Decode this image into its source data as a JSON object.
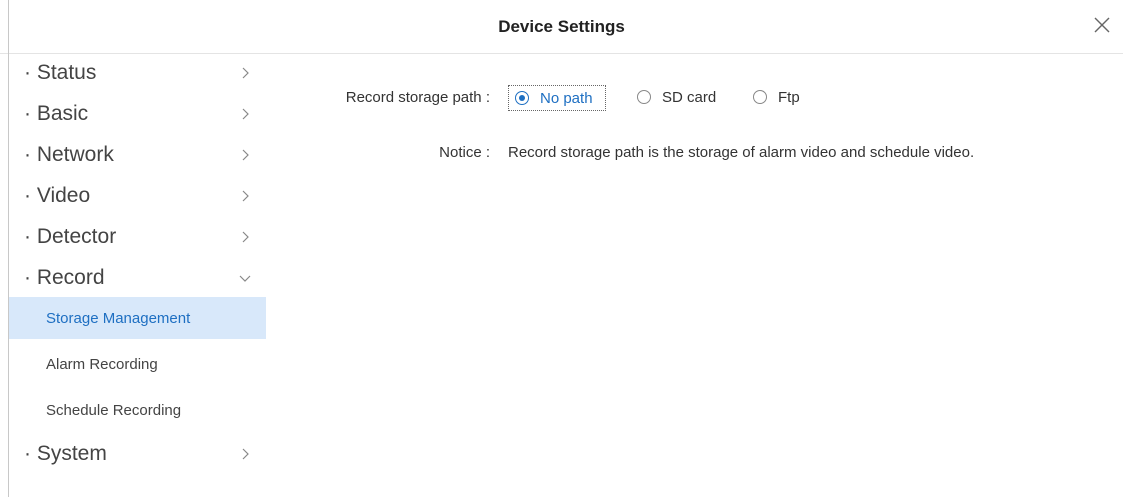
{
  "window": {
    "title": "Device Settings",
    "close_icon": "close-icon"
  },
  "sidebar": {
    "items": [
      {
        "label": "· Status",
        "chevron": "chevron-right-icon"
      },
      {
        "label": "· Basic",
        "chevron": "chevron-right-icon"
      },
      {
        "label": "· Network",
        "chevron": "chevron-right-icon"
      },
      {
        "label": "· Video",
        "chevron": "chevron-right-icon"
      },
      {
        "label": "· Detector",
        "chevron": "chevron-right-icon"
      },
      {
        "label": "· Record",
        "chevron": "chevron-down-icon",
        "expanded": true
      },
      {
        "label": "· System",
        "chevron": "chevron-right-icon"
      }
    ],
    "record_subitems": [
      {
        "label": "Storage Management",
        "active": true
      },
      {
        "label": "Alarm Recording",
        "active": false
      },
      {
        "label": "Schedule Recording",
        "active": false
      }
    ]
  },
  "main": {
    "storage_path_label": "Record storage path :",
    "storage_options": [
      {
        "label": "No path",
        "selected": true
      },
      {
        "label": "SD card",
        "selected": false
      },
      {
        "label": "Ftp",
        "selected": false
      }
    ],
    "notice_label": "Notice :",
    "notice_text": "Record storage path is the storage of alarm video and schedule video."
  },
  "colors": {
    "accent": "#1e6fc2",
    "active_bg": "#d8e8fa"
  }
}
